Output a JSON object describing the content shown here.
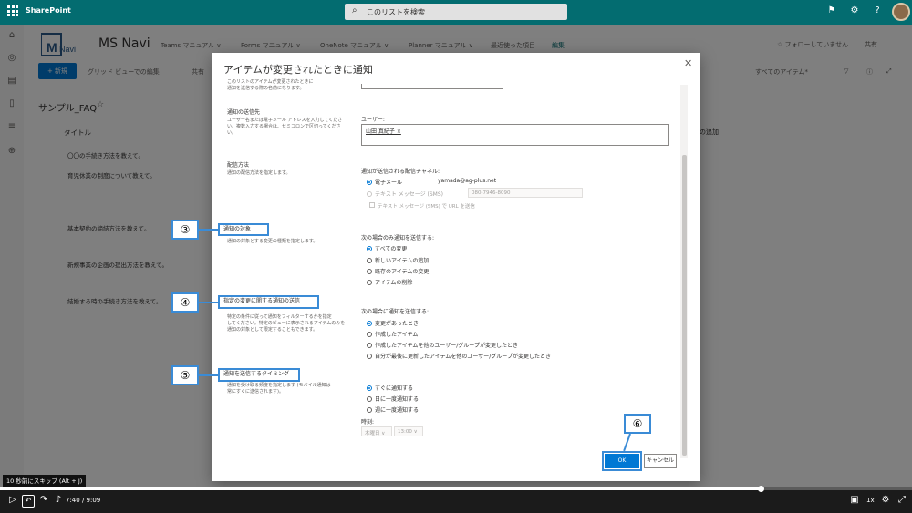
{
  "app": {
    "name": "SharePoint"
  },
  "search": {
    "placeholder": "このリストを検索"
  },
  "site": {
    "title": "MS Navi",
    "logo_text": "MS Navi",
    "nav": [
      "Teams マニュアル ∨",
      "Forms マニュアル ∨",
      "OneNote マニュアル ∨",
      "Planner マニュアル ∨",
      "最近使った項目",
      "編集"
    ],
    "follow": "☆ フォローしていません",
    "share": "共有"
  },
  "command_bar": {
    "new": "+ 新規",
    "grid_edit": "グリッド ビューでの編集",
    "share": "共有",
    "all_items": "すべてのアイテム*"
  },
  "list": {
    "title": "サンプル_FAQ",
    "column_title": "タイトル",
    "column_extra": "列の追加",
    "rows": [
      "〇〇の手続き方法を教えて。",
      "育児休業の制度について教えて。",
      "基本契約の締結方法を教えて。",
      "新規事業の企画の提出方法を教えて。",
      "結婚する時の手続き方法を教えて。"
    ]
  },
  "dialog": {
    "title": "アイテムが変更されたときに通知",
    "top_desc": [
      "このリストのアイテムが変更されたときに",
      "通知を送信する際の名前になります。"
    ],
    "recipients": {
      "title": "通知の送信先",
      "desc": [
        "ユーザー名または電子メール アドレスを入力してくださ",
        "い。複数入力する場合は、セミコロンで区切ってくださ",
        "い。"
      ],
      "label": "ユーザー:",
      "user": "山田 真紀子 ×"
    },
    "delivery": {
      "title": "配信方法",
      "desc": "通知の配信方法を指定します。",
      "label": "通知が送信される配信チャネル:",
      "email_label": "電子メール",
      "email_value": "yamada@ag-plus.net",
      "sms_label": "テキスト メッセージ (SMS)",
      "sms_value": "080-7946-8090",
      "sms_url": "テキスト メッセージ (SMS) で URL を送信"
    },
    "change_type": {
      "title": "通知の対象",
      "desc": "通知の対象とする変更の種類を指定します。",
      "label": "次の場合のみ通知を送信する:",
      "options": [
        "すべての変更",
        "新しいアイテムの追加",
        "既存のアイテムの変更",
        "アイテムの削除"
      ]
    },
    "criteria": {
      "title": "指定の変更に関する通知の送信",
      "desc": [
        "特定の条件に従って通知をフィルターするかを指定",
        "してください。特定のビューに表示されるアイテムのみを",
        "通知の対象として限定することもできます。"
      ],
      "label": "次の場合に通知を送信する:",
      "options": [
        "変更があったとき",
        "作成したアイテム",
        "作成したアイテムを他のユーザー/グループが変更したとき",
        "自分が最後に更新したアイテムを他のユーザー/グループが変更したとき"
      ]
    },
    "timing": {
      "title": "通知を送信するタイミング",
      "desc": [
        "通知を受け取る頻度を指定します (モバイル通知は",
        "常にすぐに送信されます)。"
      ],
      "options": [
        "すぐに通知する",
        "日に一度通知する",
        "週に一度通知する"
      ],
      "time_label": "時刻:",
      "day": "木曜日 ∨",
      "hour": "13:00 ∨"
    },
    "ok": "OK",
    "cancel": "キャンセル"
  },
  "annotations": {
    "n3": "③",
    "n4": "④",
    "n5": "⑤",
    "n6": "⑥"
  },
  "video": {
    "tooltip": "10 秒前にスキップ (Alt + J)",
    "time": "7:40 / 9:09",
    "speed": "1x",
    "progress": 0.835
  },
  "colors": {
    "suite_bar": "#036c70",
    "accent": "#0078d4",
    "annotation": "#3a8bd6"
  }
}
